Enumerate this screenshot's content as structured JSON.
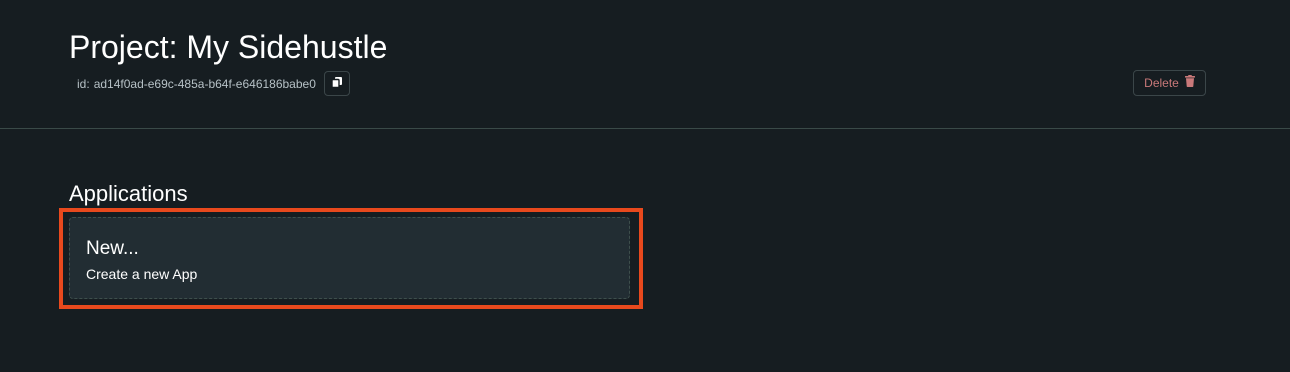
{
  "header": {
    "title": "Project: My Sidehustle",
    "id_prefix": "id:",
    "id_value": "ad14f0ad-e69c-485a-b64f-e646186babe0",
    "copy_icon": "copy-icon",
    "delete_label": "Delete",
    "delete_icon": "trash-icon"
  },
  "applications": {
    "section_title": "Applications",
    "new_card": {
      "title": "New...",
      "subtitle": "Create a new App"
    }
  },
  "colors": {
    "background": "#161d21",
    "card_background": "#222d33",
    "delete_text": "#c9797a",
    "highlight": "#e8491d",
    "divider": "#3a4a48"
  }
}
